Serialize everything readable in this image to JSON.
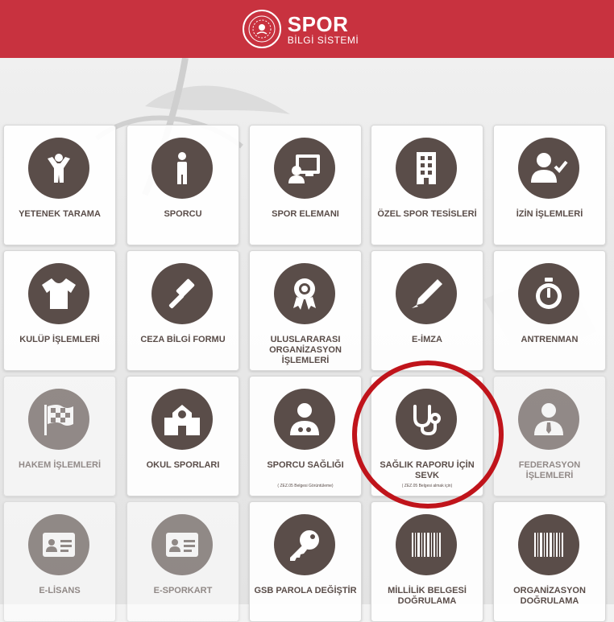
{
  "header": {
    "logo_title": "SPOR",
    "logo_subtitle": "BİLGİ SİSTEMİ",
    "background_color": "#c8323f"
  },
  "tiles": [
    {
      "label": "YETENEK TARAMA",
      "icon": "child-icon"
    },
    {
      "label": "SPORCU",
      "icon": "person-icon"
    },
    {
      "label": "SPOR ELEMANI",
      "icon": "presentation-icon"
    },
    {
      "label": "ÖZEL SPOR TESİSLERİ",
      "icon": "building-icon"
    },
    {
      "label": "İZİN İŞLEMLERİ",
      "icon": "user-check-icon"
    },
    {
      "label": "KULÜP İŞLEMLERİ",
      "icon": "tshirt-icon"
    },
    {
      "label": "CEZA BİLGİ FORMU",
      "icon": "gavel-icon"
    },
    {
      "label": "ULUSLARARASI ORGANİZASYON İŞLEMLERİ",
      "icon": "award-icon"
    },
    {
      "label": "E-İMZA",
      "icon": "pen-icon"
    },
    {
      "label": "ANTRENMAN",
      "icon": "stopwatch-icon"
    },
    {
      "label": "HAKEM İŞLEMLERİ",
      "icon": "checkered-flag-icon",
      "faded": true
    },
    {
      "label": "OKUL SPORLARI",
      "icon": "school-icon"
    },
    {
      "label": "SPORCU SAĞLIĞI",
      "sub": "( ZEZ.05 Belgesi Görüntüleme)",
      "icon": "doctor-icon"
    },
    {
      "label": "SAĞLIK RAPORU İÇİN SEVK",
      "sub": "( ZEZ.05 Belgesi almak için)",
      "icon": "stethoscope-icon"
    },
    {
      "label": "FEDERASYON İŞLEMLERİ",
      "icon": "user-tie-icon",
      "faded": true
    },
    {
      "label": "E-LİSANS",
      "icon": "id-card-icon",
      "faded": true
    },
    {
      "label": "E-SPORKART",
      "icon": "id-card-icon",
      "faded": true
    },
    {
      "label": "GSB PAROLA DEĞİŞTİR",
      "icon": "key-icon"
    },
    {
      "label": "MİLLİLİK BELGESİ DOĞRULAMA",
      "icon": "barcode-icon"
    },
    {
      "label": "ORGANİZASYON DOĞRULAMA",
      "icon": "barcode-icon"
    }
  ],
  "colors": {
    "icon_circle": "#5a4d49",
    "highlight_ring": "#c0141b"
  }
}
